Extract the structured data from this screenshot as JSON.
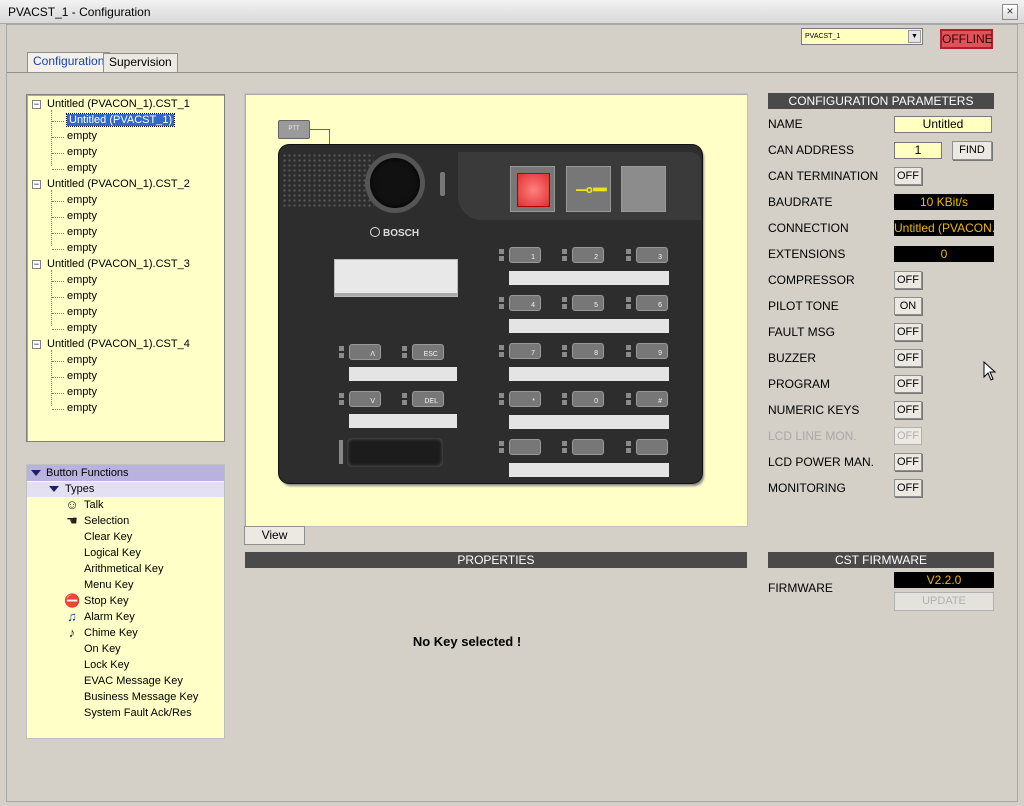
{
  "window": {
    "title": "PVACST_1 - Configuration",
    "close_glyph": "×"
  },
  "device_select": {
    "value": "PVACST_1"
  },
  "status": {
    "offline": "OFFLINE"
  },
  "tabs": [
    {
      "label": "Configuration",
      "active": true
    },
    {
      "label": "Supervision",
      "active": false
    }
  ],
  "tree": {
    "groups": [
      {
        "label": "Untitled (PVACON_1).CST_1",
        "children": [
          "Untitled (PVACST_1)",
          "empty",
          "empty",
          "empty"
        ]
      },
      {
        "label": "Untitled (PVACON_1).CST_2",
        "children": [
          "empty",
          "empty",
          "empty",
          "empty"
        ]
      },
      {
        "label": "Untitled (PVACON_1).CST_3",
        "children": [
          "empty",
          "empty",
          "empty",
          "empty"
        ]
      },
      {
        "label": "Untitled (PVACON_1).CST_4",
        "children": [
          "empty",
          "empty",
          "empty",
          "empty"
        ]
      }
    ],
    "selected": "Untitled (PVACST_1)",
    "expander": "−"
  },
  "button_functions": {
    "title": "Button Functions",
    "types_label": "Types",
    "items": [
      {
        "label": "Talk",
        "icon": "talk-person-icon"
      },
      {
        "label": "Selection",
        "icon": "selection-hand-icon"
      },
      {
        "label": "Clear Key",
        "icon": ""
      },
      {
        "label": "Logical Key",
        "icon": ""
      },
      {
        "label": "Arithmetical Key",
        "icon": ""
      },
      {
        "label": "Menu Key",
        "icon": ""
      },
      {
        "label": "Stop Key",
        "icon": "stop-sign-icon"
      },
      {
        "label": "Alarm Key",
        "icon": "alarm-bell-icon"
      },
      {
        "label": "Chime Key",
        "icon": "chime-icon"
      },
      {
        "label": "On Key",
        "icon": ""
      },
      {
        "label": "Lock Key",
        "icon": ""
      },
      {
        "label": "EVAC Message Key",
        "icon": ""
      },
      {
        "label": "Business Message Key",
        "icon": ""
      },
      {
        "label": "System Fault Ack/Res",
        "icon": ""
      }
    ]
  },
  "device": {
    "ptt_label": "PTT",
    "brand": "BOSCH",
    "keys_left": [
      "Λ",
      "ESC",
      "V",
      "DEL"
    ],
    "keys_right": [
      "1",
      "2",
      "3",
      "4",
      "5",
      "6",
      "7",
      "8",
      "9",
      "*",
      "0",
      "#",
      "",
      "",
      ""
    ]
  },
  "view_button": "View",
  "properties": {
    "title": "PROPERTIES",
    "message": "No Key selected !"
  },
  "config": {
    "title": "CONFIGURATION PARAMETERS",
    "name_label": "NAME",
    "name_value": "Untitled",
    "can_address_label": "CAN ADDRESS",
    "can_address_value": "1",
    "find_label": "FIND",
    "can_termination_label": "CAN TERMINATION",
    "can_termination_value": "OFF",
    "baudrate_label": "BAUDRATE",
    "baudrate_value": "10 KBit/s",
    "connection_label": "CONNECTION",
    "connection_value": "Untitled (PVACON...",
    "extensions_label": "EXTENSIONS",
    "extensions_value": "0",
    "toggles": [
      {
        "label": "COMPRESSOR",
        "value": "OFF",
        "disabled": false
      },
      {
        "label": "PILOT TONE",
        "value": "ON",
        "disabled": false
      },
      {
        "label": "FAULT MSG",
        "value": "OFF",
        "disabled": false
      },
      {
        "label": "BUZZER",
        "value": "OFF",
        "disabled": false
      },
      {
        "label": "PROGRAM",
        "value": "OFF",
        "disabled": false
      },
      {
        "label": "NUMERIC KEYS",
        "value": "OFF",
        "disabled": false
      },
      {
        "label": "LCD LINE MON.",
        "value": "OFF",
        "disabled": true
      },
      {
        "label": "LCD POWER MAN.",
        "value": "OFF",
        "disabled": false
      },
      {
        "label": "MONITORING",
        "value": "OFF",
        "disabled": false
      }
    ]
  },
  "firmware": {
    "title": "CST FIRMWARE",
    "label": "FIRMWARE",
    "value": "V2.2.0",
    "update_label": "UPDATE"
  },
  "colors": {
    "accent_selected": "#3169c6",
    "offline": "#e0525a",
    "yellow_panel": "#ffffc8",
    "value_text": "#f0b800"
  }
}
